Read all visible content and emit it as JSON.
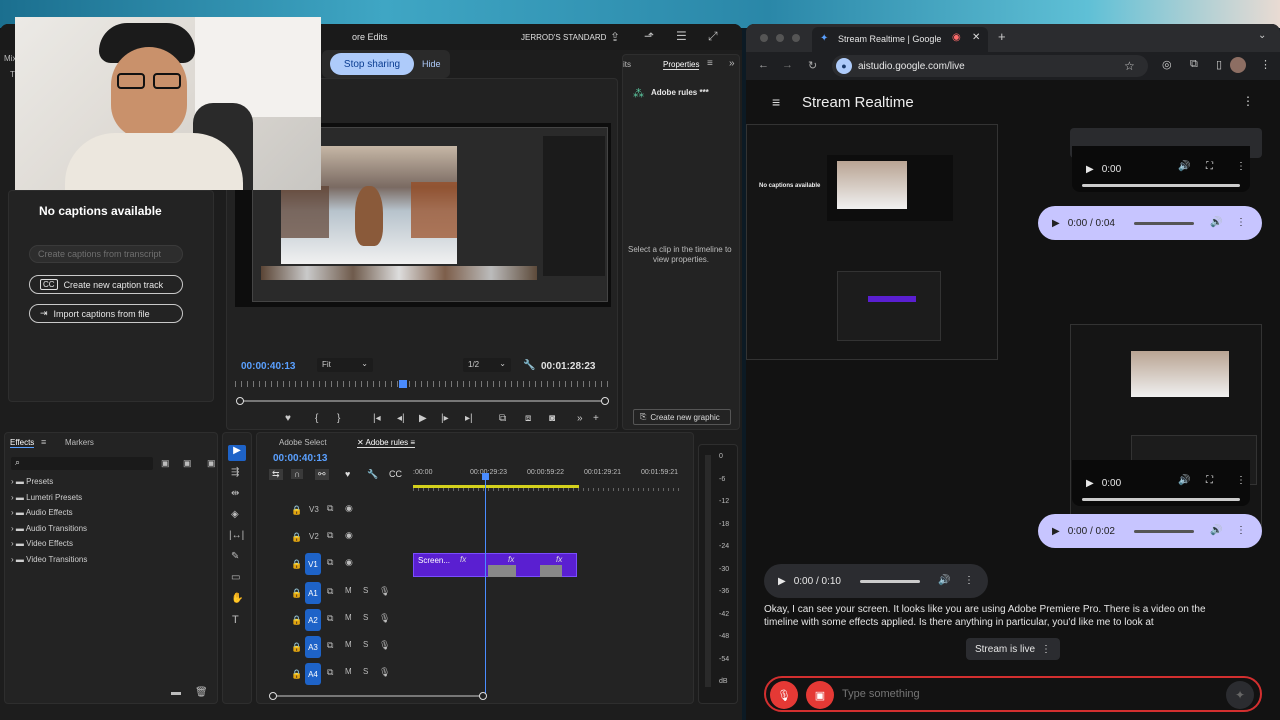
{
  "premiere": {
    "header": {
      "edits_label": "ore Edits",
      "workspace": "JERROD'S STANDARD"
    },
    "share_bar": {
      "stop_label": "Stop sharing",
      "hide_label": "Hide"
    },
    "left_tabs": {
      "mix_label": "Mix",
      "t_label": "T"
    },
    "captions": {
      "no_captions": "No captions available",
      "create_from_transcript": "Create captions from transcript",
      "create_track": "Create new caption track",
      "import_file": "Import captions from file"
    },
    "properties": {
      "tab_its": "its",
      "tab_label": "Properties",
      "rules_title": "Adobe rules ***",
      "empty_msg_1": "Select a clip in the timeline to",
      "empty_msg_2": "view properties.",
      "create_graphic": "Create new graphic"
    },
    "monitor": {
      "timecode_in": "00:00:40:13",
      "fit": "Fit",
      "resolution": "1/2",
      "timecode_total": "00:01:28:23"
    },
    "effects": {
      "tab_effects": "Effects",
      "tab_markers": "Markers",
      "items": [
        "Presets",
        "Lumetri Presets",
        "Audio Effects",
        "Audio Transitions",
        "Video Effects",
        "Video Transitions"
      ]
    },
    "timeline": {
      "tab_select": "Adobe Select",
      "tab_rules": "Adobe rules",
      "timecode": "00:00:40:13",
      "ruler": [
        ":00:00",
        "00:00:29:23",
        "00:00:59:22",
        "00:01:29:21",
        "00:01:59:21",
        "00"
      ],
      "video_tracks": [
        "V3",
        "V2",
        "V1"
      ],
      "audio_tracks": [
        "A1",
        "A2",
        "A3",
        "A4"
      ],
      "clip_label": "Screen...",
      "fx": "fx",
      "m_label": "M",
      "s_label": "S"
    },
    "meter": {
      "ticks": [
        "0",
        "-6",
        "-12",
        "-18",
        "-24",
        "-30",
        "-36",
        "-42",
        "-48",
        "-54",
        "dB"
      ]
    }
  },
  "chrome": {
    "tab_title": "Stream Realtime | Google",
    "url": "aistudio.google.com/live",
    "page_title": "Stream Realtime",
    "audio_players": [
      {
        "time": "0:00"
      },
      {
        "time": "0:00 / 0:04"
      },
      {
        "time": "0:00"
      },
      {
        "time": "0:00 / 0:02"
      },
      {
        "time": "0:00 / 0:10"
      }
    ],
    "thumb_no_captions": "No captions available",
    "response_line_1": "Okay, I can see your screen. It looks like you are using Adobe Premiere Pro. There is a video on the",
    "response_line_2": "timeline with some effects applied. Is there anything in particular, you'd like me to look at",
    "stream_status": "Stream is live",
    "input_placeholder": "Type something"
  }
}
